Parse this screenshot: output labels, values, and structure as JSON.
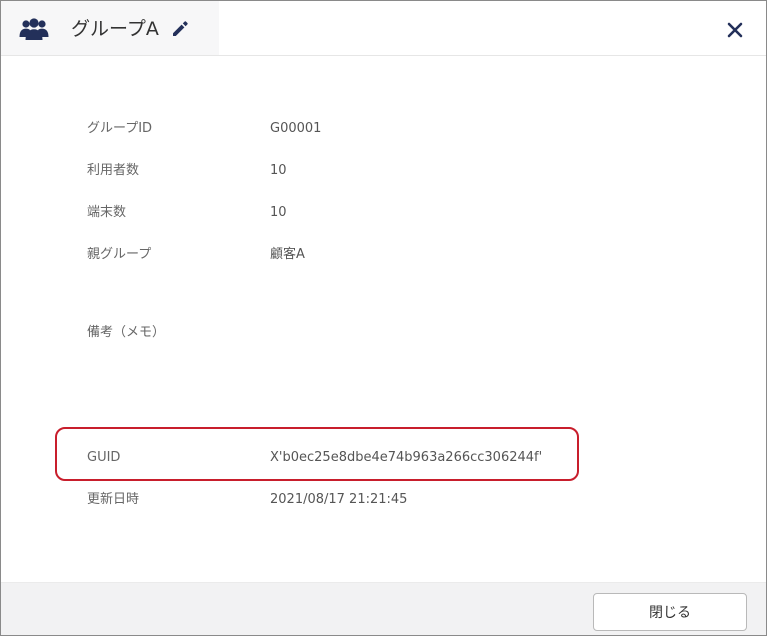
{
  "dialog": {
    "title": "グループA",
    "icons": {
      "group": "group-users-icon",
      "edit": "pencil-edit-icon",
      "close": "close-x-icon"
    }
  },
  "details": {
    "group_id": {
      "label": "グループID",
      "value": "G00001"
    },
    "user_count": {
      "label": "利用者数",
      "value": "10"
    },
    "device_count": {
      "label": "端末数",
      "value": "10"
    },
    "parent_group": {
      "label": "親グループ",
      "value": "顧客A"
    },
    "memo": {
      "label": "備考（メモ）",
      "value": ""
    },
    "guid": {
      "label": "GUID",
      "value": "X'b0ec25e8dbe4e74b963a266cc306244f'"
    },
    "updated_at": {
      "label": "更新日時",
      "value": "2021/08/17 21:21:45"
    }
  },
  "footer": {
    "close_label": "閉じる"
  },
  "colors": {
    "icon": "#23305a",
    "highlight": "#c81e2c",
    "footer_bg": "#f2f2f3"
  }
}
